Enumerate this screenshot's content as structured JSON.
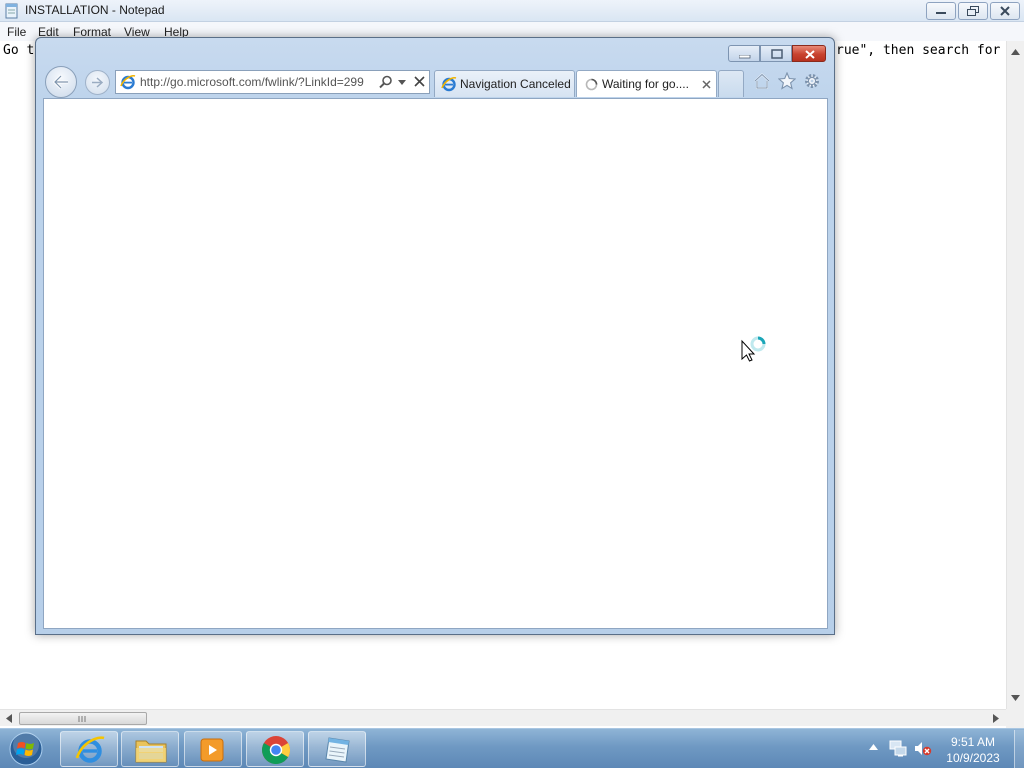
{
  "notepad": {
    "title": "INSTALLATION - Notepad",
    "menu": [
      "File",
      "Edit",
      "Format",
      "View",
      "Help"
    ],
    "text_left": "Go t",
    "text_right": "rue\", then search for"
  },
  "ie": {
    "address_url": "http://go.microsoft.com/fwlink/?LinkId=299",
    "tabs": [
      {
        "label": "Navigation Canceled",
        "active": false
      },
      {
        "label": "Waiting for go....",
        "active": true
      }
    ]
  },
  "taskbar": {
    "time": "9:51 AM",
    "date": "10/9/2023",
    "pinned": [
      "internet-explorer",
      "windows-explorer",
      "windows-media-player",
      "google-chrome",
      "notepad"
    ]
  },
  "colors": {
    "ie_frame": "#bed4ec",
    "taskbar": "#6f99c3",
    "close_red": "#c8432f"
  }
}
